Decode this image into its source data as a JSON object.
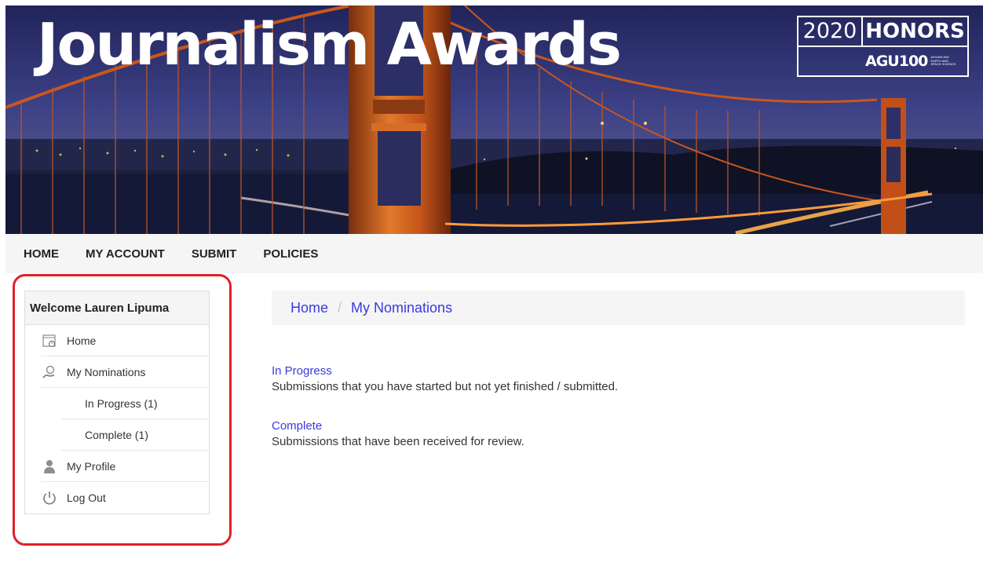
{
  "banner": {
    "title": "Journalism Awards",
    "honors_year": "2020",
    "honors_word": "HONORS",
    "agu_logo": "AGU100",
    "agu_small": "ADVANCING EARTH AND SPACE SCIENCE"
  },
  "nav": {
    "items": [
      {
        "label": "HOME"
      },
      {
        "label": "MY ACCOUNT"
      },
      {
        "label": "SUBMIT"
      },
      {
        "label": "POLICIES"
      }
    ]
  },
  "sidebar": {
    "welcome": "Welcome Lauren Lipuma",
    "items": [
      {
        "label": "Home",
        "icon": "home-icon"
      },
      {
        "label": "My Nominations",
        "icon": "nominations-icon"
      },
      {
        "label": "In Progress (1)"
      },
      {
        "label": "Complete (1)"
      },
      {
        "label": "My Profile",
        "icon": "profile-icon"
      },
      {
        "label": "Log Out",
        "icon": "power-icon"
      }
    ]
  },
  "breadcrumb": {
    "home": "Home",
    "separator": "/",
    "current": "My Nominations"
  },
  "sections": [
    {
      "title": "In Progress",
      "description": "Submissions that you have started but not yet finished / submitted."
    },
    {
      "title": "Complete",
      "description": "Submissions that have been received for review."
    }
  ],
  "colors": {
    "link": "#3a3adf",
    "highlight": "#e0202a",
    "bridge": "#c9571e"
  }
}
